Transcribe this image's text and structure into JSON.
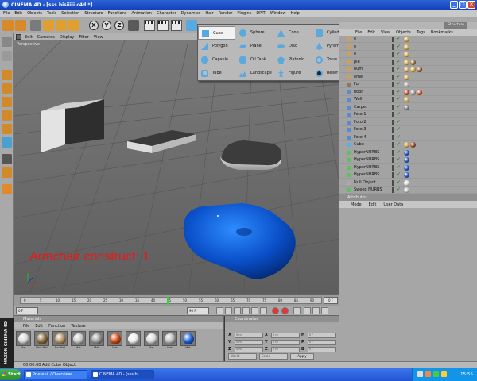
{
  "window": {
    "title": "CINEMA 4D - [sss bisiiiii.c4d *]",
    "btn_min": "_",
    "btn_max": "□",
    "btn_close": "×"
  },
  "menu": [
    "File",
    "Edit",
    "Objects",
    "Tools",
    "Selection",
    "Structure",
    "Functions",
    "Animation",
    "Character",
    "Dynamics",
    "Hair",
    "Render",
    "Plugins",
    "DPIT",
    "Window",
    "Help"
  ],
  "toolbar": {
    "x_axis": "X",
    "y_axis": "Y",
    "z_axis": "Z"
  },
  "viewport": {
    "menu": [
      "Edit",
      "Cameras",
      "Display",
      "Filter",
      "View"
    ],
    "label": "Perspective",
    "overlay_text": "Armchair construct: 1"
  },
  "primitives": [
    {
      "label": "Cube",
      "icon": "cube-icon",
      "active": true
    },
    {
      "label": "Sphere",
      "icon": "sphere-icon"
    },
    {
      "label": "Cone",
      "icon": "cone-icon"
    },
    {
      "label": "Cylinder",
      "icon": "cylinder-icon"
    },
    {
      "label": "Polygon",
      "icon": "polygon-icon"
    },
    {
      "label": "Plane",
      "icon": "plane-icon"
    },
    {
      "label": "Disc",
      "icon": "disc-icon"
    },
    {
      "label": "Pyramid",
      "icon": "pyramid-icon"
    },
    {
      "label": "Capsule",
      "icon": "capsule-icon"
    },
    {
      "label": "Oil Tank",
      "icon": "oil-tank-icon"
    },
    {
      "label": "Platonic",
      "icon": "platonic-icon"
    },
    {
      "label": "Torus",
      "icon": "torus-icon"
    },
    {
      "label": "Tube",
      "icon": "tube-icon"
    },
    {
      "label": "Landscape",
      "icon": "landscape-icon"
    },
    {
      "label": "Figure",
      "icon": "figure-icon"
    },
    {
      "label": "Relief",
      "icon": "relief-icon"
    }
  ],
  "object_manager": {
    "tab": "Structure",
    "menu": [
      "File",
      "Edit",
      "View",
      "Objects",
      "Tags",
      "Bookmarks"
    ],
    "rows": [
      {
        "name": "e",
        "icon_color": "#d0a05a",
        "tags": [
          "#c9a040"
        ]
      },
      {
        "name": "e",
        "icon_color": "#d0a05a",
        "tags": [
          "#c9a040"
        ]
      },
      {
        "name": "e",
        "icon_color": "#d0a05a",
        "tags": [
          "#c9a040"
        ]
      },
      {
        "name": "ple",
        "icon_color": "#d0a05a",
        "tags": [
          "#c9a040",
          "#8a6a3a"
        ]
      },
      {
        "name": "num",
        "icon_color": "#d0a05a",
        "tags": [
          "#c9a040",
          "#c9a040",
          "#9a4a1a"
        ]
      },
      {
        "name": "eme",
        "icon_color": "#d0a05a",
        "tags": [
          "#c9a040"
        ]
      },
      {
        "name": "Fur",
        "icon_color": "#8a7a5a",
        "tags": [
          "#aaaaaa"
        ]
      },
      {
        "name": "floor",
        "icon_color": "#5a8ad0",
        "tags": [
          "#c04010",
          "#999999",
          "#c04010"
        ]
      },
      {
        "name": "Wall",
        "icon_color": "#5a8ad0",
        "tags": [
          "#c9a040"
        ]
      },
      {
        "name": "Carpet",
        "icon_color": "#5a8ad0",
        "tags": [
          "#777777"
        ]
      },
      {
        "name": "Foto 1",
        "icon_color": "#5a8ad0",
        "tags": []
      },
      {
        "name": "Foto 2",
        "icon_color": "#5a8ad0",
        "tags": []
      },
      {
        "name": "Foto 3",
        "icon_color": "#5a8ad0",
        "tags": []
      },
      {
        "name": "Foto 4",
        "icon_color": "#5a8ad0",
        "tags": []
      },
      {
        "name": "Cube",
        "icon_color": "#5ab0e0",
        "tags": [
          "#c9a040",
          "#8a4a2a"
        ]
      },
      {
        "name": "HyperNURBS",
        "icon_color": "#60c060",
        "tags": [
          "#1a50c0"
        ]
      },
      {
        "name": "HyperNURBS",
        "icon_color": "#60c060",
        "tags": [
          "#1a50c0"
        ]
      },
      {
        "name": "HyperNURBS",
        "icon_color": "#60c060",
        "tags": [
          "#1a50c0"
        ]
      },
      {
        "name": "HyperNURBS",
        "icon_color": "#60c060",
        "tags": [
          "#1a50c0"
        ]
      },
      {
        "name": "Null Object",
        "icon_color": "#aaaaaa",
        "tags": [
          "#dddddd"
        ]
      },
      {
        "name": "Sweep NURBS",
        "icon_color": "#60c060",
        "tags": [
          "#bbbbbb"
        ]
      }
    ]
  },
  "attributes": {
    "title": "Attributes",
    "menu": [
      "Mode",
      "Edit",
      "User Data"
    ]
  },
  "timeline": {
    "ticks": [
      "0",
      "5",
      "10",
      "15",
      "20",
      "25",
      "30",
      "35",
      "40",
      "45",
      "50",
      "55",
      "60",
      "65",
      "70",
      "75",
      "80",
      "85",
      "90"
    ],
    "current_frame": "45",
    "frame_field": "0 F",
    "start_field": "0 F",
    "end_field": "90 F"
  },
  "materials": {
    "title": "Materials",
    "menu": [
      "File",
      "Edit",
      "Function",
      "Texture"
    ],
    "items": [
      {
        "label": "Mat",
        "color": "#d9d9d9"
      },
      {
        "label": "Hair Mat",
        "color": "#8a6a3a"
      },
      {
        "label": "Fur Mat",
        "color": "#b09060"
      },
      {
        "label": "Mat",
        "color": "#c8c8c8"
      },
      {
        "label": "Mat",
        "color": "#9a9a9a"
      },
      {
        "label": "Mat",
        "color": "#d04a10"
      },
      {
        "label": "Mat",
        "color": "#eeeeee"
      },
      {
        "label": "Mat",
        "color": "#d8d8d8"
      },
      {
        "label": "Mat",
        "color": "#bbbbbb"
      },
      {
        "label": "Mat",
        "color": "#1a5fd8"
      }
    ]
  },
  "coordinates": {
    "title": "Coordinates",
    "rows": [
      {
        "a": "X",
        "av": "0 m",
        "b": "X",
        "bv": "0 m",
        "c": "H",
        "cv": "0 °"
      },
      {
        "a": "Y",
        "av": "0 m",
        "b": "Y",
        "bv": "0 m",
        "c": "P",
        "cv": "0 °"
      },
      {
        "a": "Z",
        "av": "0 m",
        "b": "Z",
        "bv": "0 m",
        "c": "B",
        "cv": "0 °"
      }
    ],
    "space": "World",
    "mode": "Scale",
    "apply": "Apply"
  },
  "maxon": "MAXON CINEMA 4D",
  "status": "00:00:00  Add Cube Object",
  "taskbar": {
    "start": "Start",
    "tasks": [
      "Prietenii / Overview...",
      "CINEMA 4D - [sss b..."
    ],
    "clock": "15:55"
  }
}
